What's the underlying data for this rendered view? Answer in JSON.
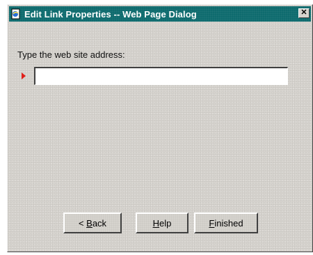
{
  "window": {
    "title": "Edit Link Properties -- Web Page Dialog",
    "close_glyph": "✕"
  },
  "form": {
    "prompt": "Type the web site address:",
    "url_value": ""
  },
  "buttons": {
    "back": {
      "prefix": "< ",
      "accel": "B",
      "rest": "ack"
    },
    "help": {
      "prefix": "",
      "accel": "H",
      "rest": "elp"
    },
    "finished": {
      "prefix": "",
      "accel": "F",
      "rest": "inished"
    }
  },
  "colors": {
    "titlebar": "#0e6b6e",
    "dialog_bg": "#d6d3ce",
    "arrow": "#e0201a"
  },
  "icons": {
    "title_icon": "ie-page-icon",
    "field_marker": "red-arrow-icon"
  }
}
